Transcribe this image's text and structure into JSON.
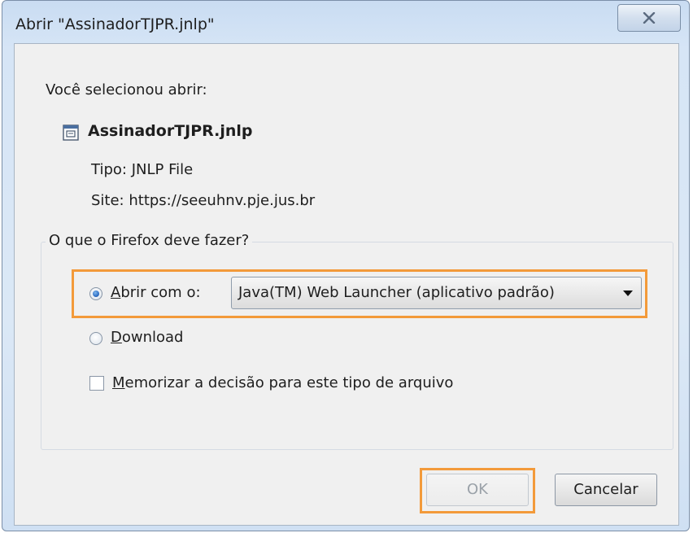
{
  "window": {
    "title": "Abrir \"AssinadorTJPR.jnlp\""
  },
  "dialog": {
    "intro": "Você selecionou abrir:",
    "file_name": "AssinadorTJPR.jnlp",
    "type_label": "Tipo:",
    "type_value": "JNLP File",
    "site_label": "Site:",
    "site_value": "https://seeuhnv.pje.jus.br"
  },
  "action_group": {
    "legend": "O que o Firefox deve fazer?",
    "open_with_label_access": "A",
    "open_with_label_rest": "brir com o:",
    "open_with_selected_app": "Java(TM) Web Launcher (aplicativo padrão)",
    "open_with_checked": true,
    "download_label_access": "D",
    "download_label_rest": "ownload",
    "download_checked": false,
    "remember_label_access": "M",
    "remember_label_rest": "emorizar a decisão para este tipo de arquivo",
    "remember_checked": false
  },
  "buttons": {
    "ok_label": "OK",
    "ok_enabled": false,
    "cancel_label": "Cancelar"
  },
  "icons": {
    "close": "close-icon",
    "file": "jnlp-file-icon",
    "dropdown": "chevron-down-icon"
  },
  "colors": {
    "highlight": "#f39a3a",
    "radio_selected": "#2f6fc4"
  }
}
